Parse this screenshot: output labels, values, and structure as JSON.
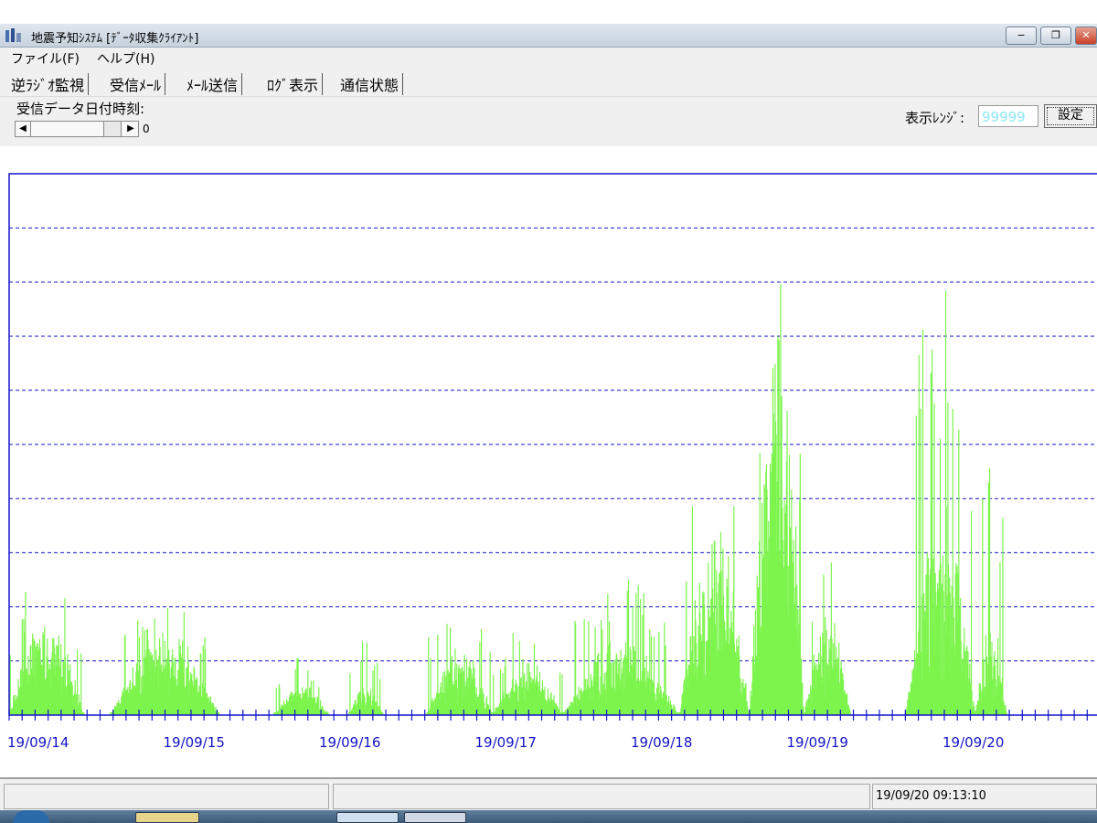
{
  "window": {
    "title": "地震予知ｼｽﾃﾑ [ﾃﾞｰﾀ収集ｸﾗｲｱﾝﾄ]",
    "minimize_label": "−",
    "restore_label": "❐",
    "close_label": "✕"
  },
  "menu": {
    "items": [
      "ファイル(F)",
      "ヘルプ(H)"
    ]
  },
  "tabs": [
    "逆ﾗｼﾞｵ監視",
    "受信ﾒｰﾙ",
    "ﾒｰﾙ送信",
    "ﾛｸﾞ表示",
    "通信状態"
  ],
  "controls": {
    "date_label": "受信データ日付時刻:",
    "slider_value": "0",
    "range_label": "表示ﾚﾝｼﾞ:",
    "range_value": "99999",
    "set_button": "設定"
  },
  "chart_data": {
    "type": "bar",
    "x_tick_labels": [
      "19/09/14",
      "19/09/15",
      "19/09/16",
      "19/09/17",
      "19/09/18",
      "19/09/19",
      "19/09/20"
    ],
    "xlim_days": [
      0,
      7.0
    ],
    "ylim": [
      0,
      99999
    ],
    "grid": true,
    "grid_lines": 9,
    "color": "#7cf44c",
    "axis_color": "#1414c8",
    "bursts": [
      {
        "start": 0.0,
        "end": 0.48,
        "peak": 0.28,
        "base": 0.1
      },
      {
        "start": 0.65,
        "end": 1.35,
        "peak": 0.22,
        "base": 0.08
      },
      {
        "start": 1.7,
        "end": 2.05,
        "peak": 0.11,
        "base": 0.03
      },
      {
        "start": 2.18,
        "end": 2.4,
        "peak": 0.15,
        "base": 0.02
      },
      {
        "start": 2.68,
        "end": 3.1,
        "peak": 0.28,
        "base": 0.05
      },
      {
        "start": 3.1,
        "end": 3.55,
        "peak": 0.17,
        "base": 0.05
      },
      {
        "start": 3.55,
        "end": 4.3,
        "peak": 0.27,
        "base": 0.06
      },
      {
        "start": 4.3,
        "end": 4.75,
        "peak": 0.5,
        "base": 0.2
      },
      {
        "start": 4.75,
        "end": 5.1,
        "peak": 0.82,
        "base": 0.45
      },
      {
        "start": 5.1,
        "end": 5.4,
        "peak": 0.3,
        "base": 0.1
      },
      {
        "start": 5.75,
        "end": 6.2,
        "peak": 0.85,
        "base": 0.15
      },
      {
        "start": 6.2,
        "end": 6.4,
        "peak": 0.55,
        "base": 0.05
      }
    ]
  },
  "status": {
    "left": "",
    "middle": "",
    "time": "19/09/20 09:13:10"
  }
}
